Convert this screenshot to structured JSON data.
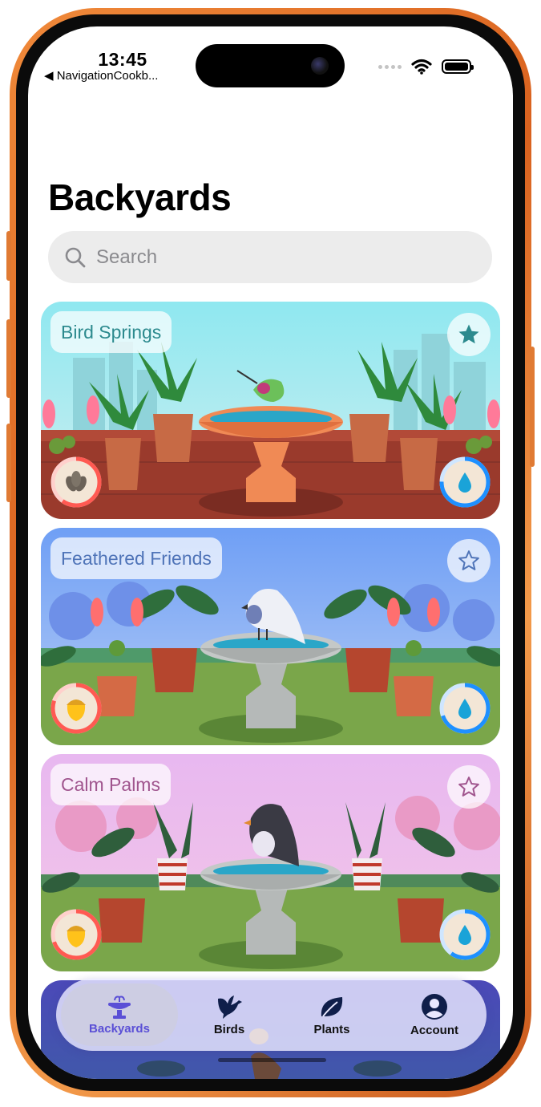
{
  "status_bar": {
    "time": "13:45",
    "back_app": "◀ NavigationCookb..."
  },
  "page": {
    "title": "Backyards"
  },
  "search": {
    "placeholder": "Search"
  },
  "cards": [
    {
      "name": "Bird Springs",
      "favorite": true,
      "food": "sunflower-seeds",
      "food_level": 0.6,
      "water_level": 0.75
    },
    {
      "name": "Feathered Friends",
      "favorite": false,
      "food": "acorn",
      "food_level": 0.8,
      "water_level": 0.7
    },
    {
      "name": "Calm Palms",
      "favorite": false,
      "food": "acorn",
      "food_level": 0.7,
      "water_level": 0.6
    }
  ],
  "tabs": [
    {
      "label": "Backyards",
      "icon": "birdbath-icon",
      "selected": true
    },
    {
      "label": "Birds",
      "icon": "bird-icon",
      "selected": false
    },
    {
      "label": "Plants",
      "icon": "leaf-icon",
      "selected": false
    },
    {
      "label": "Account",
      "icon": "person-icon",
      "selected": false
    }
  ],
  "colors": {
    "accent": "#5a4fd6",
    "water": "#1e90ff",
    "food": "#ff5a52"
  }
}
